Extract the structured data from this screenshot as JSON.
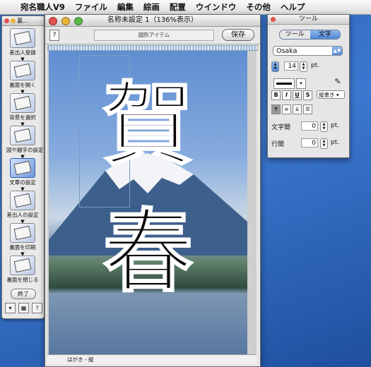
{
  "menubar": {
    "app_name": "宛名職人V9",
    "items": [
      "ファイル",
      "編集",
      "綜画",
      "配置",
      "ウインドウ",
      "その他",
      "ヘルプ"
    ]
  },
  "left_palette": {
    "title": "裏...",
    "tools": [
      {
        "label": "差出人登録",
        "icon": "sender-register-icon"
      },
      {
        "label": "裏面を開く",
        "icon": "open-back-icon"
      },
      {
        "label": "背景を選択",
        "icon": "background-select-icon"
      },
      {
        "label": "図や題字の設定",
        "icon": "figure-title-settings-icon"
      },
      {
        "label": "文章の設定",
        "icon": "text-settings-icon",
        "selected": true
      },
      {
        "label": "差出人の設定",
        "icon": "sender-settings-icon"
      },
      {
        "label": "裏面を印刷",
        "icon": "print-back-icon"
      },
      {
        "label": "裏面を閉じる",
        "icon": "close-back-icon"
      }
    ],
    "end_button": "終了",
    "help_button": "?"
  },
  "main_window": {
    "title": "名称未設定 1（136%表示）",
    "help_button": "?",
    "item_field": "図形アイテム",
    "save_button": "保存",
    "calligraphy": [
      "賀",
      "春"
    ],
    "status_label": "はがき - 縦"
  },
  "tool_palette": {
    "title": "ツール",
    "tabs": [
      {
        "label": "ツール",
        "active": false
      },
      {
        "label": "文字",
        "active": true
      }
    ],
    "font": "Osaka",
    "font_size": "14",
    "size_unit": "pt.",
    "style_buttons": [
      "B",
      "I",
      "U",
      "S"
    ],
    "direction_select": "縦書き",
    "char_spacing_label": "文字間",
    "char_spacing_value": "0",
    "char_spacing_unit": "pt.",
    "line_spacing_label": "行間",
    "line_spacing_value": "0",
    "line_spacing_unit": "pt."
  },
  "colors": {
    "accent": "#4f87d6",
    "desktop": "#2d63b5"
  }
}
